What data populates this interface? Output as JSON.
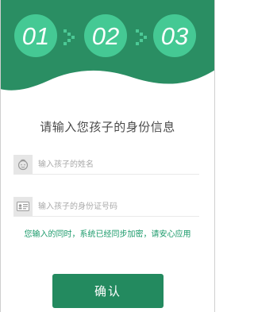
{
  "colors": {
    "brand_green": "#2a8e63",
    "step_circle": "#45c994",
    "notice_text": "#1a9a6a",
    "button": "#238a5f"
  },
  "steps": [
    "01",
    "02",
    "03"
  ],
  "title": "请输入您孩子的身份信息",
  "fields": {
    "name": {
      "icon": "child-face-icon",
      "placeholder": "输入孩子的姓名"
    },
    "id_number": {
      "icon": "id-card-icon",
      "placeholder": "输入孩子的身份证号码"
    }
  },
  "notice": "您输入的同时，系统已经同步加密，请安心应用",
  "confirm_label": "确认"
}
